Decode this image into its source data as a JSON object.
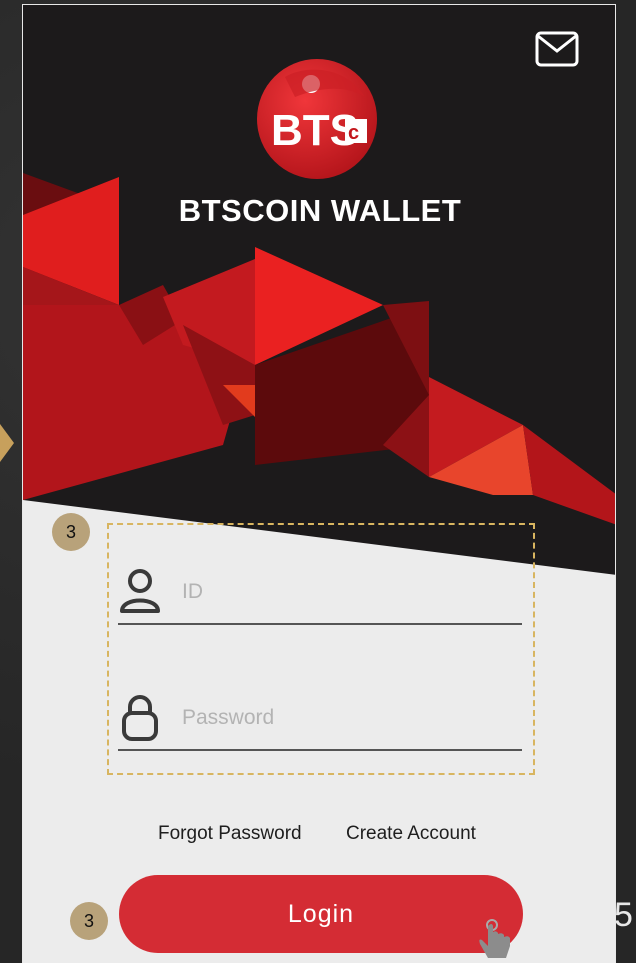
{
  "app": {
    "brand_name": "BTSCOIN WALLET",
    "logo_text": "BTSc"
  },
  "form": {
    "id_placeholder": "ID",
    "password_placeholder": "Password",
    "forgot_label": "Forgot Password",
    "create_label": "Create Account",
    "login_label": "Login"
  },
  "annotations": {
    "badge_top": "3",
    "badge_bottom": "3"
  },
  "page": {
    "number": "5"
  },
  "colors": {
    "accent": "#d42c34",
    "hero_dark": "#1c1a1b",
    "annotation": "#d8b560"
  },
  "icons": {
    "mail": "mail-icon",
    "user": "user-icon",
    "lock": "lock-icon",
    "pointer": "hand-pointer-icon"
  }
}
